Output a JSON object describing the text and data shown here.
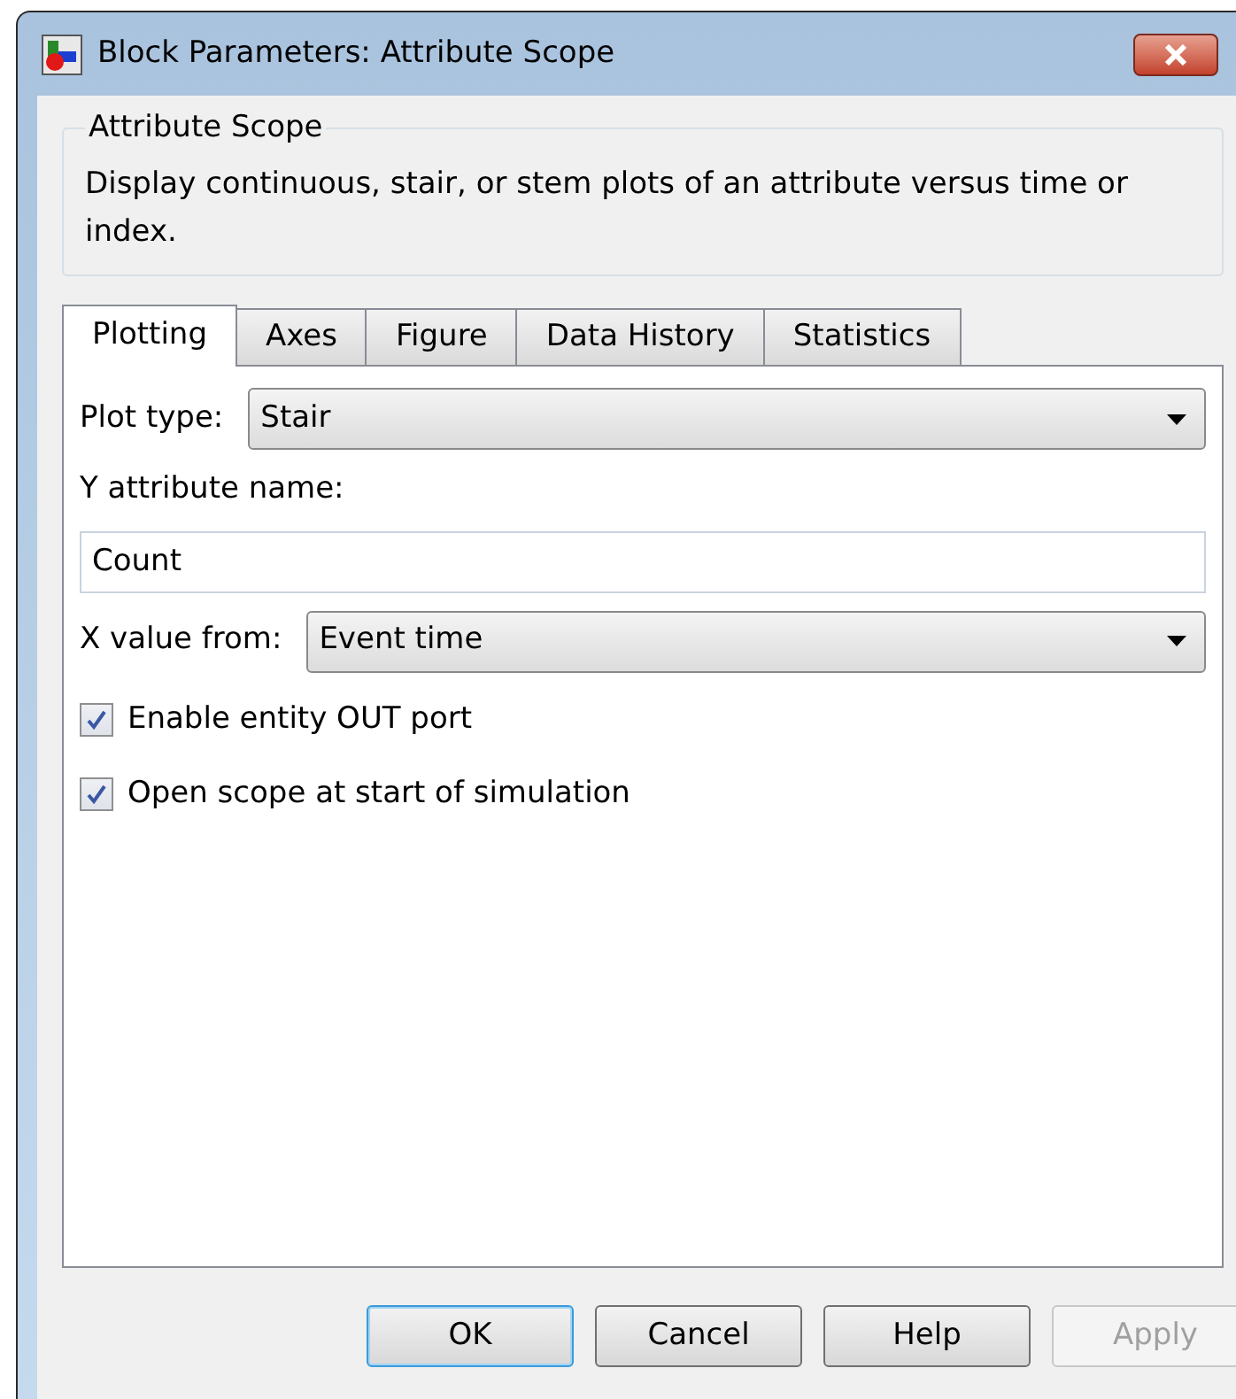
{
  "window": {
    "title": "Block Parameters: Attribute Scope"
  },
  "group": {
    "title": "Attribute Scope",
    "description": "Display continuous, stair, or stem plots of an attribute versus time or index."
  },
  "tabs": [
    {
      "label": "Plotting",
      "selected": true
    },
    {
      "label": "Axes",
      "selected": false
    },
    {
      "label": "Figure",
      "selected": false
    },
    {
      "label": "Data History",
      "selected": false
    },
    {
      "label": "Statistics",
      "selected": false
    }
  ],
  "fields": [
    {
      "kind": "dropdown",
      "label": "Plot type:",
      "value": "Stair"
    },
    {
      "kind": "text",
      "label": "Y attribute name:",
      "value": "Count"
    },
    {
      "kind": "dropdown",
      "label": "X value from:",
      "value": "Event time"
    },
    {
      "kind": "checkbox",
      "label": "Enable entity OUT port",
      "checked": true
    },
    {
      "kind": "checkbox",
      "label": "Open scope at start of simulation",
      "checked": true
    }
  ],
  "buttons": [
    {
      "label": "OK",
      "default": true,
      "disabled": false
    },
    {
      "label": "Cancel",
      "default": false,
      "disabled": false
    },
    {
      "label": "Help",
      "default": false,
      "disabled": false
    },
    {
      "label": "Apply",
      "default": false,
      "disabled": true
    }
  ]
}
